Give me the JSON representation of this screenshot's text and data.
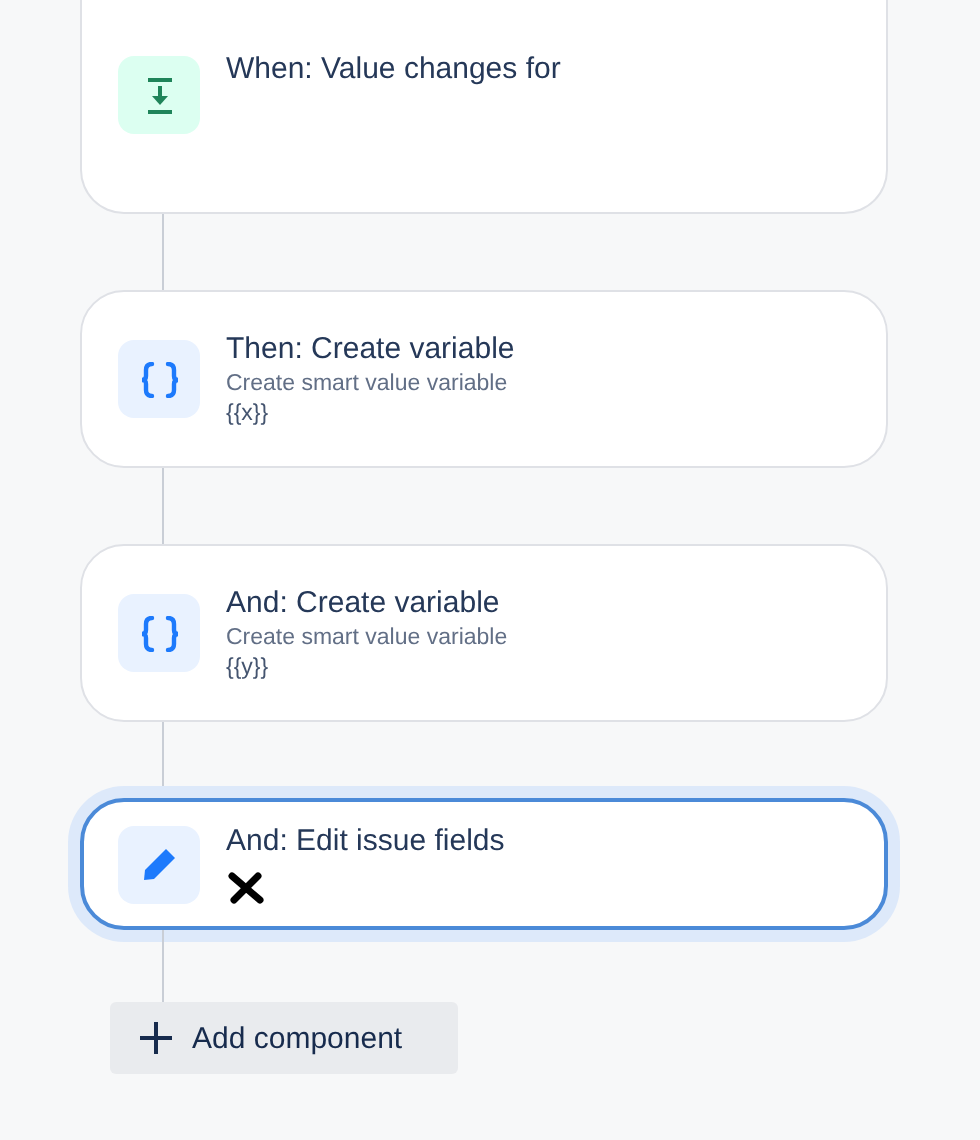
{
  "steps": [
    {
      "kind": "trigger",
      "title": "When: Value changes for",
      "selected": false,
      "redacted": false
    },
    {
      "kind": "variable",
      "title": "Then: Create variable",
      "subtitle": "Create smart value variable",
      "value": "{{x}}",
      "selected": false,
      "redacted": false
    },
    {
      "kind": "variable",
      "title": "And: Create variable",
      "subtitle": "Create smart value variable",
      "value": "{{y}}",
      "selected": false,
      "redacted": false
    },
    {
      "kind": "edit",
      "title": "And: Edit issue fields",
      "selected": true,
      "redacted": true
    }
  ],
  "add_button": {
    "label": "Add component"
  }
}
